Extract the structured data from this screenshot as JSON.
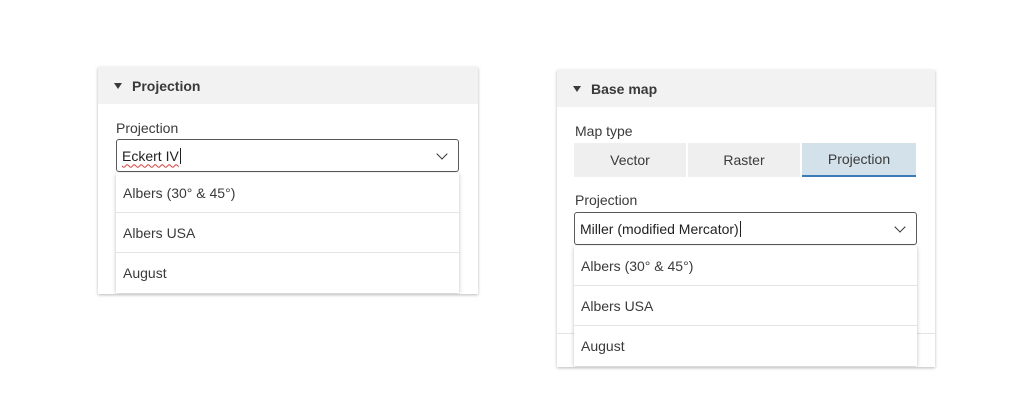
{
  "left_panel": {
    "header": "Projection",
    "field_label": "Projection",
    "value": "Eckert IV",
    "options": [
      "Albers (30° & 45°)",
      "Albers USA",
      "August"
    ]
  },
  "right_panel": {
    "header": "Base map",
    "map_type_label": "Map type",
    "map_type_options": [
      "Vector",
      "Raster",
      "Projection"
    ],
    "map_type_selected": "Projection",
    "field_label": "Projection",
    "value": "Miller (modified Mercator)",
    "options": [
      "Albers (30° & 45°)",
      "Albers USA",
      "August"
    ]
  },
  "colors": {
    "header_bg": "#f2f2f2",
    "segment_active_bg": "#d3e1ea",
    "segment_active_underline": "#3b7cb6",
    "spellcheck_underline": "#d43f3a"
  }
}
